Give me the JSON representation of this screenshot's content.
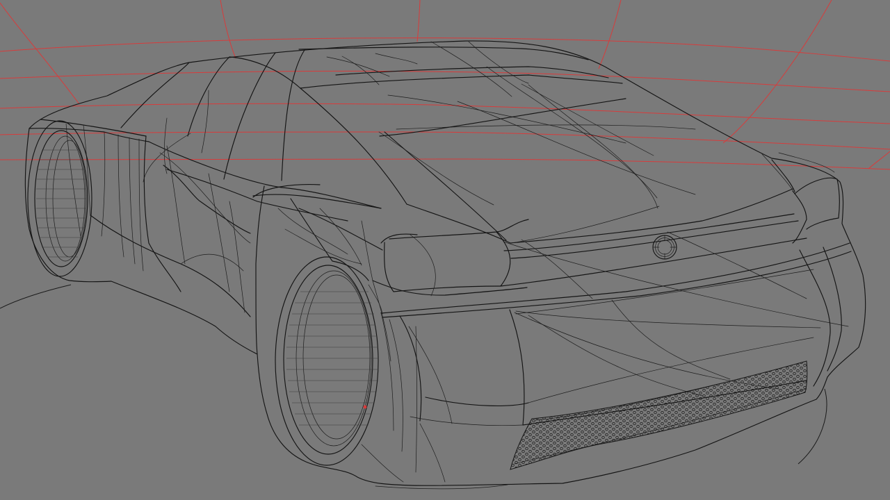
{
  "viewport": {
    "background_color": "#7a7a7a",
    "wire_color": "#141414",
    "grid_color": "#d83b3b"
  },
  "objects": {
    "model": "car-wireframe",
    "badge": "circular-emblem",
    "grille": "honeycomb-grille"
  }
}
